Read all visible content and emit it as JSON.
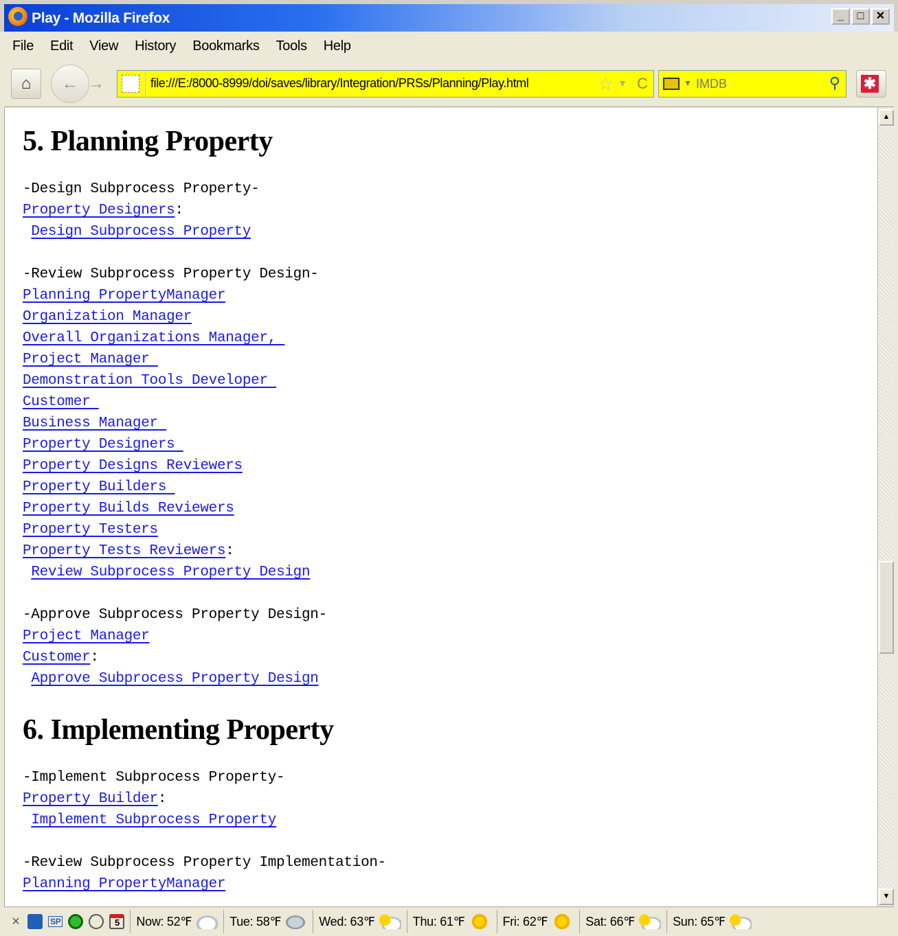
{
  "window": {
    "title": "Play - Mozilla Firefox",
    "min_label": "_",
    "max_label": "□",
    "close_label": "✕"
  },
  "menu": {
    "items": [
      "File",
      "Edit",
      "View",
      "History",
      "Bookmarks",
      "Tools",
      "Help"
    ]
  },
  "nav": {
    "home_glyph": "⌂",
    "back_glyph": "←",
    "forward_glyph": "→",
    "url": "file:///E:/8000-8999/doi/saves/library/Integration/PRSs/Planning/Play.html",
    "star_glyph": "☆",
    "reload_glyph": "C",
    "search_placeholder": "IMDB",
    "search_glyph": "⚲",
    "addon_glyph": "✱"
  },
  "content": {
    "section5": {
      "heading": "5. Planning Property",
      "design": {
        "header": "-Design Subprocess Property-",
        "actor": "Property Designers",
        "colon": ":",
        "action": "Design Subprocess Property"
      },
      "review": {
        "header": "-Review Subprocess Property Design-",
        "actors": [
          "Planning PropertyManager",
          "Organization Manager",
          "Overall Organizations Manager, ",
          "Project Manager ",
          "Demonstration Tools Developer ",
          "Customer ",
          "Business Manager ",
          "Property Designers ",
          "Property Designs Reviewers",
          "Property Builders ",
          "Property Builds Reviewers",
          "Property Testers",
          "Property Tests Reviewers"
        ],
        "colon": ":",
        "action": "Review Subprocess Property Design"
      },
      "approve": {
        "header": "-Approve Subprocess Property Design-",
        "actors": [
          "Project Manager",
          "Customer"
        ],
        "colon": ":",
        "action": "Approve Subprocess Property Design"
      }
    },
    "section6": {
      "heading": "6. Implementing Property",
      "implement": {
        "header": "-Implement Subprocess Property-",
        "actor": "Property Builder",
        "colon": ":",
        "action": "Implement Subprocess Property"
      },
      "review_impl": {
        "header": "-Review Subprocess Property Implementation-",
        "first_actor": "Planning PropertyManager"
      }
    }
  },
  "statusbar": {
    "close_glyph": "×",
    "sp_label": "SP",
    "calendar_day": "5",
    "weather": [
      {
        "label": "Now: 52℉",
        "icon": "cloud"
      },
      {
        "label": "Tue: 58℉",
        "icon": "rain"
      },
      {
        "label": "Wed: 63℉",
        "icon": "partly"
      },
      {
        "label": "Thu: 61℉",
        "icon": "sun"
      },
      {
        "label": "Fri: 62℉",
        "icon": "sun"
      },
      {
        "label": "Sat: 66℉",
        "icon": "partly"
      },
      {
        "label": "Sun: 65℉",
        "icon": "partly"
      }
    ]
  },
  "colors": {
    "link": "#1a1aee",
    "urlbar_bg": "#ffff00",
    "titlebar": "#0a3fd6"
  }
}
